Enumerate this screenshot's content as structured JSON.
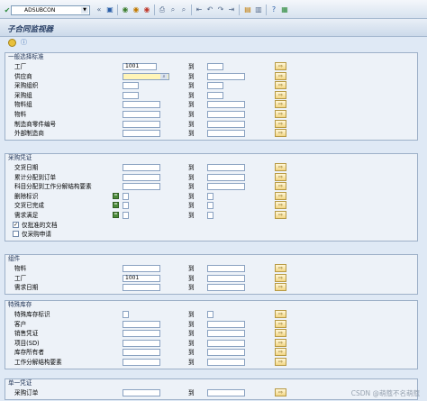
{
  "toolbar": {
    "tcode_value": "ADSUBCON",
    "icons": [
      "enter-icon",
      "save-icon",
      "back-icon",
      "exit-icon",
      "cancel-icon",
      "print-icon",
      "find-icon",
      "find-next-icon",
      "first-page-icon",
      "prev-page-icon",
      "next-page-icon",
      "last-page-icon",
      "new-session-icon",
      "shortcut-icon",
      "help-icon",
      "layout-icon"
    ]
  },
  "title": "子合同监视器",
  "app_toolbar": {
    "execute": "execute-icon",
    "info": "info-icon"
  },
  "to_label": "到",
  "groups": [
    {
      "header": "一般选择标准",
      "rows": [
        {
          "label": "工厂",
          "value": "1001",
          "to": ""
        },
        {
          "label": "供应商",
          "value": "",
          "to": "",
          "required": true
        },
        {
          "label": "采购组织",
          "value": "",
          "to": ""
        },
        {
          "label": "采购组",
          "value": "",
          "to": ""
        },
        {
          "label": "物料组",
          "value": "",
          "to": ""
        },
        {
          "label": "物料",
          "value": "",
          "to": ""
        },
        {
          "label": "制造商零件编号",
          "value": "",
          "to": ""
        },
        {
          "label": "外部制造商",
          "value": "",
          "to": ""
        }
      ]
    },
    {
      "header": "采购凭证",
      "rows": [
        {
          "label": "交货日期",
          "value": "",
          "to": ""
        },
        {
          "label": "累计分配到订单",
          "value": "",
          "to": ""
        },
        {
          "label": "科目分配到工作分解结构要素",
          "value": "",
          "to": ""
        },
        {
          "label": "删除标识",
          "value": "",
          "to": ""
        },
        {
          "label": "交货已完成",
          "value": "",
          "to": ""
        },
        {
          "label": "需求满足",
          "value": "",
          "to": ""
        }
      ],
      "checkboxes": [
        {
          "label": "仅批准的文档",
          "checked": true
        },
        {
          "label": "仅采购申请",
          "checked": false
        }
      ]
    },
    {
      "header": "组件",
      "rows": [
        {
          "label": "物料",
          "value": "",
          "to": ""
        },
        {
          "label": "工厂",
          "value": "1001",
          "to": ""
        },
        {
          "label": "需求日期",
          "value": "",
          "to": ""
        }
      ]
    },
    {
      "header": "特殊库存",
      "rows": [
        {
          "label": "特殊库存标识",
          "value": "",
          "to": ""
        },
        {
          "label": "客户",
          "value": "",
          "to": ""
        },
        {
          "label": "销售凭证",
          "value": "",
          "to": ""
        },
        {
          "label": "项目(SD)",
          "value": "",
          "to": ""
        },
        {
          "label": "库存所有者",
          "value": "",
          "to": ""
        },
        {
          "label": "工作分解结构要素",
          "value": "",
          "to": ""
        }
      ]
    },
    {
      "header": "单一凭证",
      "rows": [
        {
          "label": "采购订单",
          "value": "",
          "to": ""
        }
      ]
    }
  ],
  "watermark": "CSDN @萌蔻不名萌蔻"
}
